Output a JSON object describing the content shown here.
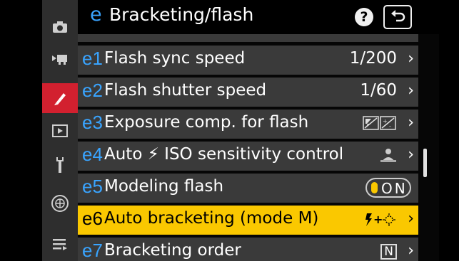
{
  "header": {
    "letter": "e",
    "title": "Bracketing/flash",
    "help": "?",
    "back_icon": "return-arrow-icon"
  },
  "sidebar": {
    "items": [
      {
        "icon": "camera-icon",
        "active": false
      },
      {
        "icon": "movie-camera-icon",
        "active": false
      },
      {
        "icon": "pencil-icon",
        "active": true
      },
      {
        "icon": "playback-icon",
        "active": false
      },
      {
        "icon": "wrench-icon",
        "active": false
      },
      {
        "icon": "network-icon",
        "active": false
      },
      {
        "icon": "menu-list-icon",
        "active": false
      }
    ]
  },
  "rows": [
    {
      "code": "e1",
      "label": "Flash sync speed",
      "value": "1/200"
    },
    {
      "code": "e2",
      "label": "Flash shutter speed",
      "value": "1/60"
    },
    {
      "code": "e3",
      "label": "Exposure comp. for flash",
      "value_icon": "flash-exposure-comp-icon"
    },
    {
      "code": "e4",
      "label": "Auto ⚡ ISO sensitivity control",
      "value_icon": "subject-and-background-icon"
    },
    {
      "code": "e5",
      "label": "Modeling flash",
      "value": "ON"
    },
    {
      "code": "e6",
      "label": "Auto bracketing (mode M)",
      "value_icon": "flash-plus-speed-icon",
      "selected": true
    },
    {
      "code": "e7",
      "label": "Bracketing order",
      "value": "N"
    }
  ],
  "colors": {
    "accent": "#39a4ff",
    "selected": "#fac800",
    "active_tab": "#d2202f"
  }
}
